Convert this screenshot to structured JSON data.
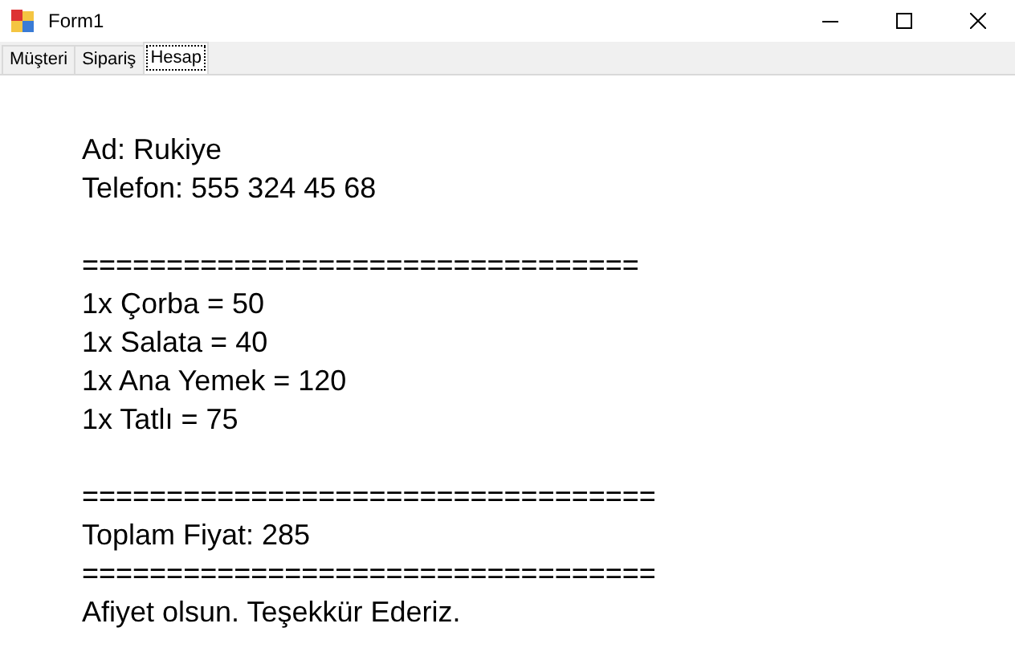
{
  "window": {
    "title": "Form1"
  },
  "tabs": [
    {
      "label": "Müşteri",
      "selected": false
    },
    {
      "label": "Sipariş",
      "selected": false
    },
    {
      "label": "Hesap",
      "selected": true
    }
  ],
  "blocks": [
    [
      "Ad: Rukiye",
      "Telefon: 555 324 45 68"
    ],
    [
      "=================================",
      "1x Çorba = 50",
      "1x Salata = 40",
      "1x Ana Yemek = 120",
      "1x Tatlı = 75"
    ],
    [
      "==================================",
      "Toplam Fiyat: 285",
      "==================================",
      "Afiyet olsun. Teşekkür Ederiz."
    ]
  ]
}
